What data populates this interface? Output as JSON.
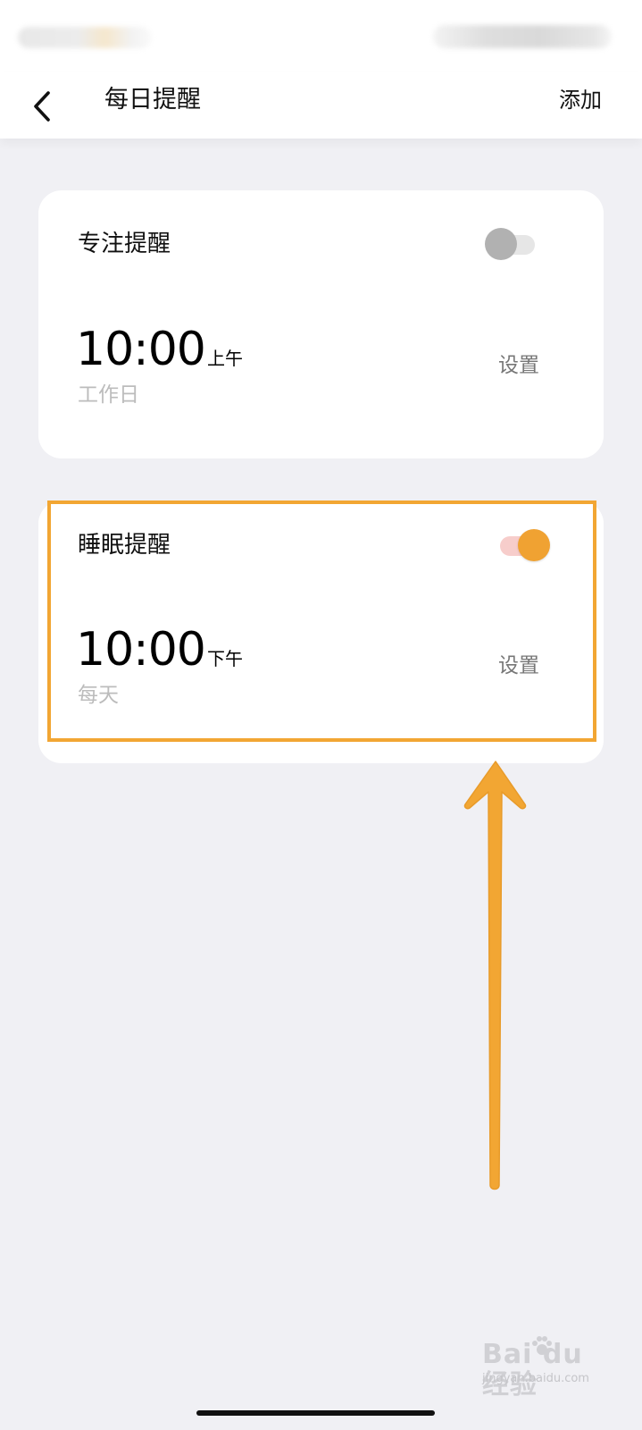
{
  "header": {
    "title": "每日提醒",
    "add_label": "添加",
    "back_icon": "chevron-left-icon"
  },
  "reminders": [
    {
      "name": "专注提醒",
      "enabled": false,
      "time": "10:00",
      "period": "上午",
      "repeat": "工作日",
      "set_label": "设置"
    },
    {
      "name": "睡眠提醒",
      "enabled": true,
      "time": "10:00",
      "period": "下午",
      "repeat": "每天",
      "set_label": "设置"
    }
  ],
  "annotation": {
    "color": "#f2a633",
    "arrow_icon": "up-arrow-icon"
  },
  "colors": {
    "toggle_on_knob": "#f0a232",
    "toggle_on_track": "#f7cdcb",
    "toggle_off_knob": "#b1b1b1",
    "toggle_off_track": "#e6e6e6",
    "background": "#f0f0f4"
  },
  "watermark": {
    "brand": "Bai du 经验",
    "url": "jingyan.baidu.com"
  }
}
